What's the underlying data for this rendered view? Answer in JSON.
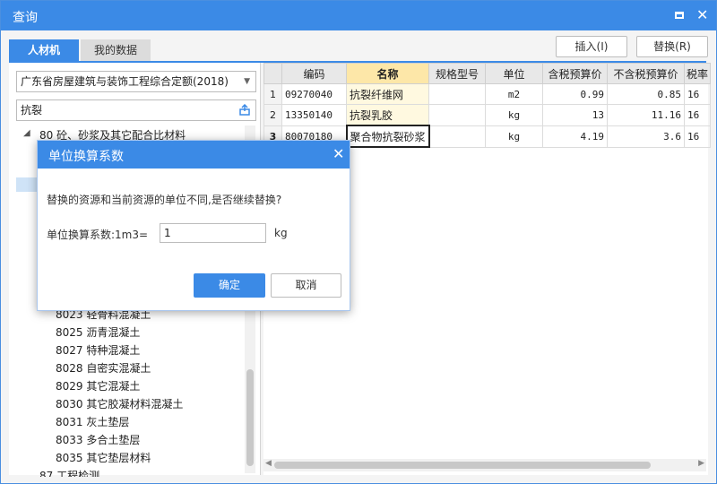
{
  "window": {
    "title": "查询"
  },
  "tabs": [
    {
      "label": "人材机"
    },
    {
      "label": "我的数据"
    }
  ],
  "toolbar": {
    "insert_label": "插入(I)",
    "replace_label": "替换(R)"
  },
  "left": {
    "quota_select": "广东省房屋建筑与装饰工程综合定额(2018)",
    "search_value": "抗裂",
    "tree_parent": "80 砼、砂浆及其它配合比材料",
    "tree_children": [
      "8023 轻骨料混凝土",
      "8025 沥青混凝土",
      "8027 特种混凝土",
      "8028 自密实混凝土",
      "8029 其它混凝土",
      "8030 其它胶凝材料混凝土",
      "8031 灰土垫层",
      "8033 多合土垫层",
      "8035 其它垫层材料"
    ],
    "tree_next": "87 工程检测"
  },
  "table": {
    "headers": [
      "编码",
      "名称",
      "规格型号",
      "单位",
      "含税预算价",
      "不含税预算价",
      "税率"
    ],
    "rows": [
      {
        "index": "1",
        "code": "09270040",
        "name": "抗裂纤维网",
        "spec": "",
        "unit": "m2",
        "price_tax": "0.99",
        "price_notax": "0.85",
        "rate": "16"
      },
      {
        "index": "2",
        "code": "13350140",
        "name": "抗裂乳胶",
        "spec": "",
        "unit": "kg",
        "price_tax": "13",
        "price_notax": "11.16",
        "rate": "16"
      },
      {
        "index": "3",
        "code": "80070180",
        "name": "聚合物抗裂砂浆",
        "spec": "",
        "unit": "kg",
        "price_tax": "4.19",
        "price_notax": "3.6",
        "rate": "16"
      }
    ]
  },
  "dialog": {
    "title": "单位换算系数",
    "message": "替换的资源和当前资源的单位不同,是否继续替换?",
    "factor_label": "单位换算系数:1m3=",
    "factor_value": "1",
    "unit": "kg",
    "ok_label": "确定",
    "cancel_label": "取消"
  },
  "colors": {
    "accent": "#3b8ae6",
    "header_highlight": "#fde7a8"
  }
}
